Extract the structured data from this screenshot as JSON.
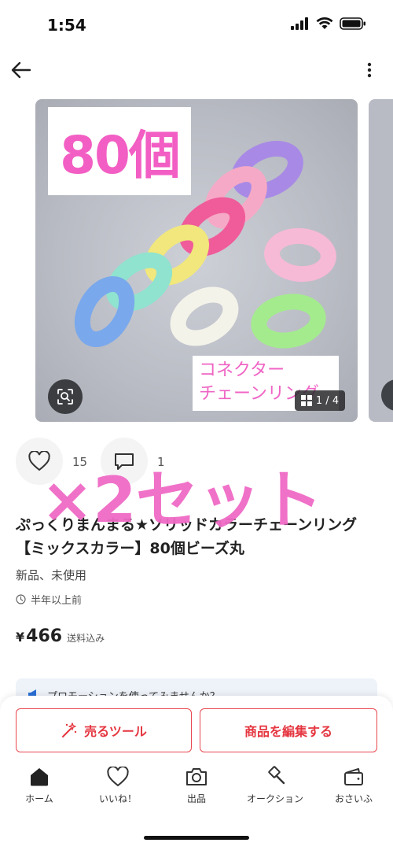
{
  "status_bar": {
    "time": "1:54"
  },
  "header": {
    "back_icon": "arrow-left-icon",
    "more_icon": "more-vertical-icon"
  },
  "image": {
    "label_count": "80個",
    "label_connector_line1": "コネクター",
    "label_connector_line2": "チェーンリング",
    "page_indicator": "1 / 4"
  },
  "reactions": {
    "likes": "15",
    "comments": "1"
  },
  "overlay_text": "×2セット",
  "product": {
    "title": "ぷっくりまんまる★ソリッドカラーチェーンリング【ミックスカラー】80個ビーズ丸",
    "condition": "新品、未使用",
    "posted": "半年以上前",
    "price_symbol": "¥",
    "price": "466",
    "shipping": "送料込み"
  },
  "promo": {
    "text": "プロモーションを使ってみませんか？"
  },
  "actions": {
    "sell_tools": "売るツール",
    "edit_item": "商品を編集する"
  },
  "tabs": [
    {
      "label": "ホーム",
      "icon": "home-icon"
    },
    {
      "label": "いいね！",
      "icon": "heart-icon"
    },
    {
      "label": "出品",
      "icon": "camera-icon"
    },
    {
      "label": "オークション",
      "icon": "gavel-icon"
    },
    {
      "label": "おさいふ",
      "icon": "wallet-icon"
    }
  ],
  "colors": {
    "accent": "#e53640",
    "overlay_pink": "#f06ac6"
  }
}
